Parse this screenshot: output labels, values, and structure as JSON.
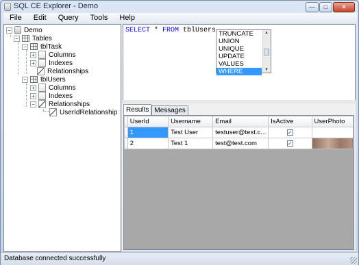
{
  "window": {
    "title": "SQL CE Explorer - Demo",
    "buttons": {
      "minimize": "—",
      "maximize": "□",
      "close": "✕"
    }
  },
  "menu": [
    "File",
    "Edit",
    "Query",
    "Tools",
    "Help"
  ],
  "tree": {
    "root": "Demo",
    "tables_label": "Tables",
    "tables": [
      {
        "name": "tblTask",
        "children": [
          "Columns",
          "Indexes",
          "Relationships"
        ]
      },
      {
        "name": "tblUsers",
        "children": [
          "Columns",
          "Indexes",
          "Relationships"
        ],
        "relationship": "UserIdRelationship"
      }
    ]
  },
  "query": {
    "kw_select": "SELECT",
    "star": " * ",
    "kw_from": "FROM",
    "table": " tblUsers"
  },
  "autocomplete": {
    "items": [
      "TRUNCATE",
      "UNION",
      "UNIQUE",
      "UPDATE",
      "VALUES",
      "WHERE"
    ],
    "selected": "WHERE"
  },
  "tabs": {
    "results": "Results",
    "messages": "Messages"
  },
  "grid": {
    "columns": [
      "UserId",
      "Username",
      "Email",
      "IsActive",
      "UserPhoto"
    ],
    "rows": [
      {
        "userid": "1",
        "username": "Test User",
        "email": "testuser@test.c...",
        "isactive": "✓"
      },
      {
        "userid": "2",
        "username": "Test 1",
        "email": "test@test.com",
        "isactive": "✓"
      }
    ]
  },
  "status": {
    "text": "Database connected successfully"
  }
}
